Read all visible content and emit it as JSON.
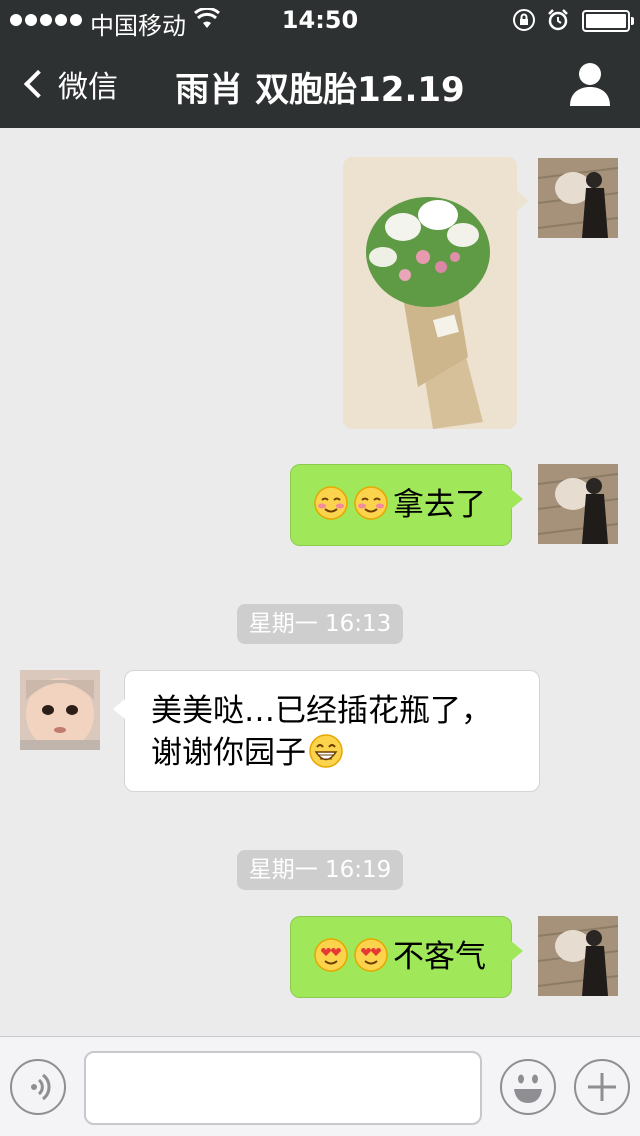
{
  "status_bar": {
    "carrier": "中国移动",
    "time": "14:50",
    "icons": [
      "signal-dots-icon",
      "wifi-icon",
      "rotation-lock-icon",
      "alarm-icon",
      "battery-icon"
    ]
  },
  "nav": {
    "back_label": "微信",
    "title": "雨肖 双胞胎12.19",
    "profile_icon": "person-icon"
  },
  "messages": [
    {
      "direction": "out",
      "type": "image",
      "image": "bouquet-photo"
    },
    {
      "direction": "out",
      "type": "text",
      "emojis": [
        "blush-emoji",
        "blush-emoji"
      ],
      "text": "拿去了"
    },
    {
      "type": "timestamp",
      "text": "星期一 16:13"
    },
    {
      "direction": "in",
      "type": "text",
      "line1": "美美哒…已经插花瓶了，",
      "line2": "谢谢你园子",
      "emojis": [
        "grin-emoji"
      ]
    },
    {
      "type": "timestamp",
      "text": "星期一 16:19"
    },
    {
      "direction": "out",
      "type": "text",
      "emojis": [
        "heart-eyes-emoji",
        "heart-eyes-emoji"
      ],
      "text": "不客气"
    }
  ],
  "input_bar": {
    "voice_icon": "voice-icon",
    "emoji_icon": "smiley-icon",
    "plus_icon": "plus-icon",
    "input_value": ""
  },
  "colors": {
    "nav_bg": "#2e3132",
    "chat_bg": "#ebebeb",
    "out_bubble": "#a0e75a",
    "in_bubble": "#ffffff"
  }
}
